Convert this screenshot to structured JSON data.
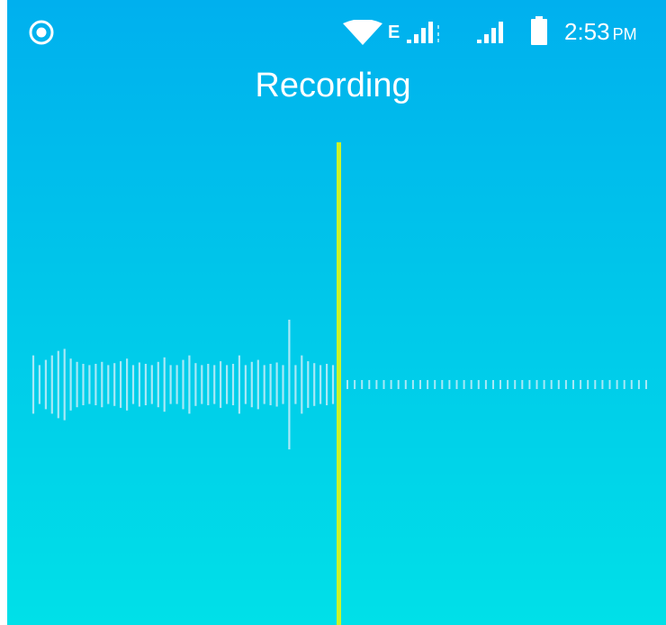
{
  "status_bar": {
    "network_type": "E",
    "time": "2:53",
    "ampm": "PM",
    "icons": [
      "record-indicator-icon",
      "wifi-icon",
      "signal-icon",
      "signal-icon",
      "battery-icon"
    ]
  },
  "title": "Recording",
  "colors": {
    "background_top": "#00b0ee",
    "background_bottom": "#00e0e8",
    "playhead": "#c9f32a",
    "waveform": "#a8e8f7"
  },
  "waveform": {
    "recorded_amplitudes": [
      0.45,
      0.3,
      0.38,
      0.45,
      0.52,
      0.55,
      0.4,
      0.35,
      0.32,
      0.3,
      0.32,
      0.35,
      0.3,
      0.33,
      0.36,
      0.4,
      0.3,
      0.34,
      0.32,
      0.3,
      0.35,
      0.42,
      0.3,
      0.3,
      0.38,
      0.45,
      0.33,
      0.3,
      0.32,
      0.3,
      0.36,
      0.3,
      0.32,
      0.45,
      0.3,
      0.35,
      0.38,
      0.3,
      0.32,
      0.34,
      0.3,
      1.0,
      0.3,
      0.45,
      0.36,
      0.33,
      0.3,
      0.32,
      0.3
    ],
    "pending_ticks": 42
  }
}
